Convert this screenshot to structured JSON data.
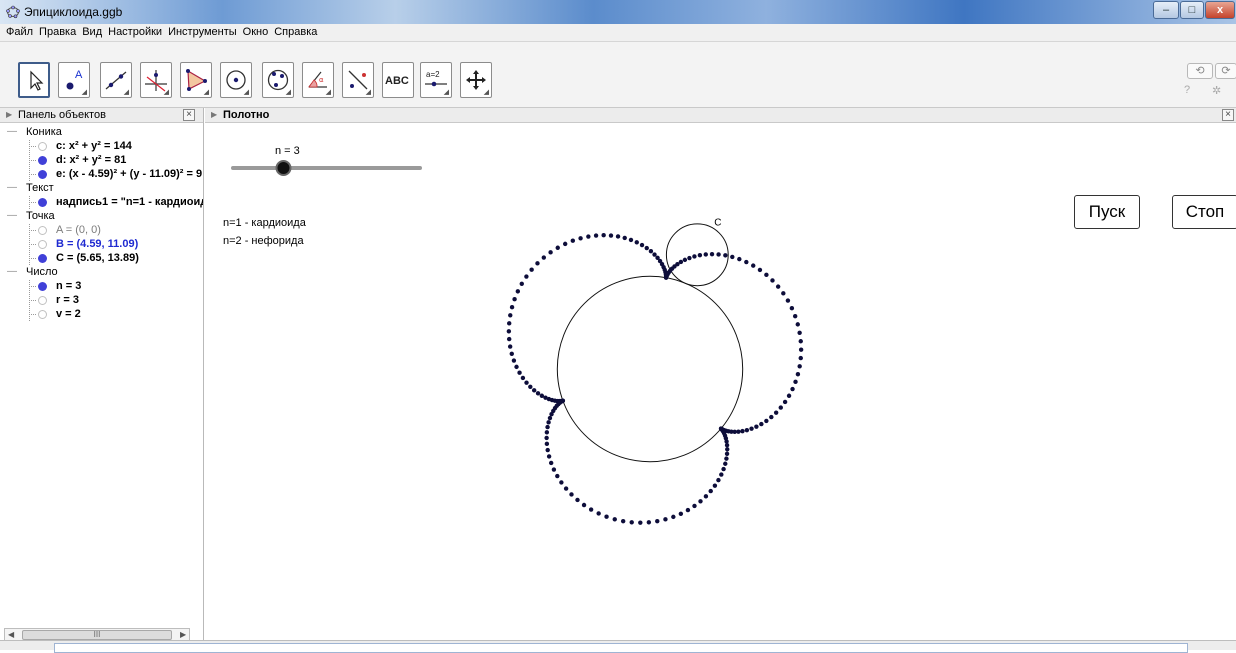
{
  "window": {
    "title": "Эпициклоида.ggb",
    "minimize": "–",
    "maximize": "□",
    "close": "x"
  },
  "menu": [
    "Файл",
    "Правка",
    "Вид",
    "Настройки",
    "Инструменты",
    "Окно",
    "Справка"
  ],
  "toolbar": {
    "tools": [
      {
        "icon": "move-arrow-icon"
      },
      {
        "icon": "point-icon",
        "letter": "A"
      },
      {
        "icon": "line-icon"
      },
      {
        "icon": "perpendicular-icon"
      },
      {
        "icon": "polygon-icon"
      },
      {
        "icon": "circle-center-point-icon"
      },
      {
        "icon": "circle-three-points-icon"
      },
      {
        "icon": "angle-icon"
      },
      {
        "icon": "reflect-icon"
      },
      {
        "icon": "text-icon",
        "label": "ABC"
      },
      {
        "icon": "slider-icon",
        "label": "a=2"
      },
      {
        "icon": "move-graphics-icon"
      }
    ],
    "undo": "⟲",
    "redo": "⟳",
    "help": "?",
    "settings": "✲"
  },
  "algebra": {
    "header": "Панель объектов",
    "categories": [
      {
        "label": "Коника",
        "items": [
          {
            "text": "c: x² + y² = 144",
            "shown": false,
            "kind": "dep"
          },
          {
            "text": "d: x² + y² = 81",
            "shown": true,
            "kind": "dep"
          },
          {
            "text": "e: (x - 4.59)² + (y - 11.09)² = 9",
            "shown": true,
            "kind": "dep"
          }
        ]
      },
      {
        "label": "Текст",
        "items": [
          {
            "text": "надпись1 = \"n=1 - кардиоид",
            "shown": true,
            "kind": "dep"
          }
        ]
      },
      {
        "label": "Точка",
        "items": [
          {
            "text": "A = (0, 0)",
            "shown": false,
            "kind": "aux"
          },
          {
            "text": "B = (4.59, 11.09)",
            "shown": false,
            "kind": "free"
          },
          {
            "text": "C = (5.65, 13.89)",
            "shown": true,
            "kind": "dep"
          }
        ]
      },
      {
        "label": "Число",
        "items": [
          {
            "text": "n = 3",
            "shown": true,
            "kind": "dep"
          },
          {
            "text": "r = 3",
            "shown": false,
            "kind": "dep"
          },
          {
            "text": "v = 2",
            "shown": false,
            "kind": "dep"
          }
        ]
      }
    ],
    "scroll_label": "III"
  },
  "graphics": {
    "header": "Полотно",
    "slider": {
      "label": "n = 3",
      "value": 3,
      "min": 0,
      "max": 10
    },
    "text_lines": [
      "n=1 - кардиоида",
      "n=2 - нефорида"
    ],
    "point_label": "C",
    "buttons": {
      "start": "Пуск",
      "stop": "Стоп"
    },
    "curve": {
      "R": 9,
      "r": 3,
      "k": 3,
      "color": "#0d0d3a",
      "moving_angle_deg": 67.5
    }
  }
}
